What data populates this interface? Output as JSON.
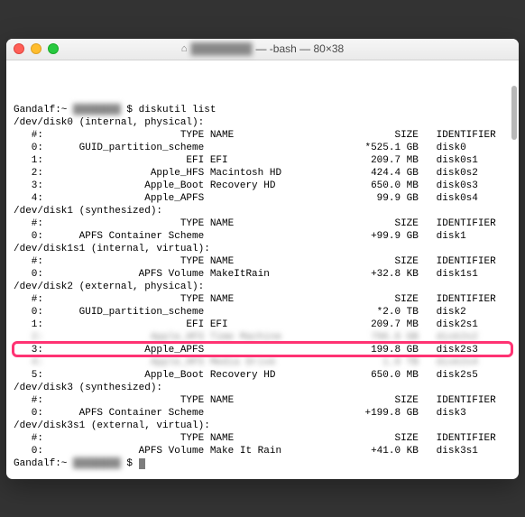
{
  "window": {
    "title_user": "████████",
    "title_suffix": " — -bash — 80×38"
  },
  "prompt": {
    "host": "Gandalf",
    "path": "~",
    "user_mask": "████████",
    "sep": "$"
  },
  "command": "diskutil list",
  "hdr": {
    "num": "#:",
    "type": "TYPE",
    "name": "NAME",
    "size": "SIZE",
    "id": "IDENTIFIER"
  },
  "disks": [
    {
      "header": "/dev/disk0 (internal, physical):",
      "rows": [
        {
          "n": "0:",
          "type": "GUID_partition_scheme",
          "name": "",
          "size": "*525.1 GB",
          "id": "disk0"
        },
        {
          "n": "1:",
          "type": "EFI",
          "name": "EFI",
          "size": "209.7 MB",
          "id": "disk0s1"
        },
        {
          "n": "2:",
          "type": "Apple_HFS",
          "name": "Macintosh HD",
          "size": "424.4 GB",
          "id": "disk0s2"
        },
        {
          "n": "3:",
          "type": "Apple_Boot",
          "name": "Recovery HD",
          "size": "650.0 MB",
          "id": "disk0s3"
        },
        {
          "n": "4:",
          "type": "Apple_APFS",
          "name": "",
          "size": "99.9 GB",
          "id": "disk0s4"
        }
      ]
    },
    {
      "header": "/dev/disk1 (synthesized):",
      "rows": [
        {
          "n": "0:",
          "type": "APFS Container Scheme",
          "name": "",
          "size": "+99.9 GB",
          "id": "disk1"
        }
      ]
    },
    {
      "header": "/dev/disk1s1 (internal, virtual):",
      "rows": [
        {
          "n": "0:",
          "type": "APFS Volume",
          "name": "MakeItRain",
          "size": "+32.8 KB",
          "id": "disk1s1"
        }
      ]
    },
    {
      "header": "/dev/disk2 (external, physical):",
      "rows": [
        {
          "n": "0:",
          "type": "GUID_partition_scheme",
          "name": "",
          "size": "*2.0 TB",
          "id": "disk2"
        },
        {
          "n": "1:",
          "type": "EFI",
          "name": "EFI",
          "size": "209.7 MB",
          "id": "disk2s1"
        },
        {
          "n": "2:",
          "type": "Apple_HFS",
          "name": "Time Machine",
          "size": "796.0 GB",
          "id": "disk2s2",
          "mask": true
        },
        {
          "n": "3:",
          "type": "Apple_APFS",
          "name": "",
          "size": "199.8 GB",
          "id": "disk2s3",
          "highlight": true
        },
        {
          "n": "4:",
          "type": "Apple_HFS",
          "name": "Media Drive",
          "size": "1.0 TB",
          "id": "disk2s4",
          "mask": true
        },
        {
          "n": "5:",
          "type": "Apple_Boot",
          "name": "Recovery HD",
          "size": "650.0 MB",
          "id": "disk2s5"
        }
      ]
    },
    {
      "header": "/dev/disk3 (synthesized):",
      "rows": [
        {
          "n": "0:",
          "type": "APFS Container Scheme",
          "name": "",
          "size": "+199.8 GB",
          "id": "disk3"
        }
      ]
    },
    {
      "header": "/dev/disk3s1 (external, virtual):",
      "rows": [
        {
          "n": "0:",
          "type": "APFS Volume",
          "name": "Make It Rain",
          "size": "+41.0 KB",
          "id": "disk3s1"
        }
      ]
    }
  ]
}
